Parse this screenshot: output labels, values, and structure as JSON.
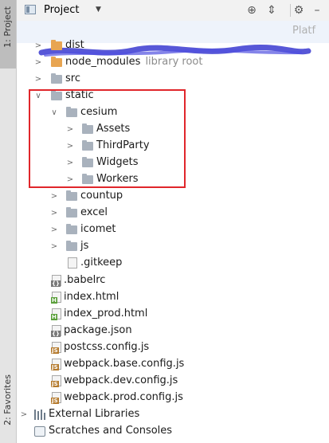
{
  "sidebar": {
    "project_tab": "1: Project",
    "favorites_tab": "2: Favorites"
  },
  "header": {
    "title": "Project",
    "dropdown_icon": "chevron-down-icon",
    "toolbar_icons": [
      "locate-icon",
      "collapse-icon",
      "gear-icon",
      "hide-icon"
    ]
  },
  "colors": {
    "highlight": "#e0262b",
    "folder": "#a9b2bd",
    "excluded_folder": "#e8a552"
  },
  "root_hidden_text": "Platf",
  "tree": {
    "dist": "dist",
    "node_modules": "node_modules",
    "node_modules_hint": "library root",
    "src": "src",
    "static": "static",
    "cesium": "cesium",
    "assets": "Assets",
    "thirdparty": "ThirdParty",
    "widgets": "Widgets",
    "workers": "Workers",
    "countup": "countup",
    "excel": "excel",
    "icomet": "icomet",
    "js": "js",
    "gitkeep": ".gitkeep",
    "babelrc": ".babelrc",
    "index_html": "index.html",
    "index_prod_html": "index_prod.html",
    "package_json": "package.json",
    "postcss": "postcss.config.js",
    "webpack_base": "webpack.base.config.js",
    "webpack_dev": "webpack.dev.config.js",
    "webpack_prod": "webpack.prod.config.js",
    "external_libraries": "External Libraries",
    "scratches": "Scratches and Consoles"
  },
  "badges": {
    "js": "JS",
    "html": "H",
    "json": "{}"
  }
}
